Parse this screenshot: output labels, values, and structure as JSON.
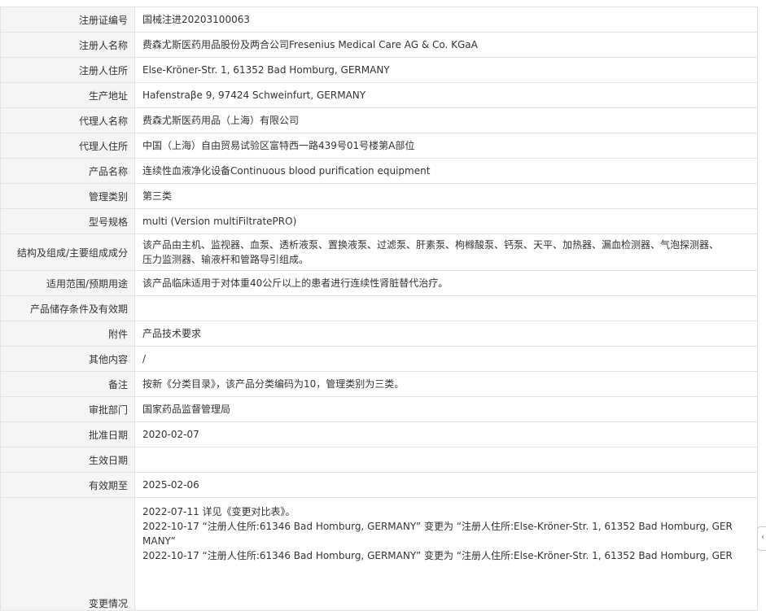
{
  "rows": [
    {
      "label": "注册证编号",
      "value": [
        "国械注进20203100063"
      ]
    },
    {
      "label": "注册人名称",
      "value": [
        "费森尤斯医药用品股份及两合公司Fresenius Medical Care AG & Co. KGaA"
      ]
    },
    {
      "label": "注册人住所",
      "value": [
        "Else-Kröner-Str. 1, 61352 Bad Homburg, GERMANY"
      ]
    },
    {
      "label": "生产地址",
      "value": [
        "Hafenstraβe 9, 97424 Schweinfurt, GERMANY"
      ]
    },
    {
      "label": "代理人名称",
      "value": [
        "费森尤斯医药用品（上海）有限公司"
      ]
    },
    {
      "label": "代理人住所",
      "value": [
        "中国（上海）自由贸易试验区富特西一路439号01号楼第A部位"
      ]
    },
    {
      "label": "产品名称",
      "value": [
        "连续性血液净化设备Continuous blood purification equipment"
      ]
    },
    {
      "label": "管理类别",
      "value": [
        "第三类"
      ]
    },
    {
      "label": "型号规格",
      "value": [
        "multi (Version multiFiltratePRO)"
      ]
    },
    {
      "label": "结构及组成/主要组成成分",
      "value": [
        "该产品由主机、监视器、血泵、透析液泵、置换液泵、过滤泵、肝素泵、枸橼酸泵、钙泵、天平、加热器、漏血检测器、气泡探测器、",
        "压力监测器、输液杆和管路导引组成。"
      ]
    },
    {
      "label": "适用范围/预期用途",
      "value": [
        "该产品临床适用于对体重40公斤以上的患者进行连续性肾脏替代治疗。"
      ]
    },
    {
      "label": "产品储存条件及有效期",
      "value": [
        ""
      ]
    },
    {
      "label": "附件",
      "value": [
        "产品技术要求"
      ]
    },
    {
      "label": "其他内容",
      "value": [
        "/"
      ]
    },
    {
      "label": "备注",
      "value": [
        "按新《分类目录》，该产品分类编码为10，管理类别为三类。"
      ]
    },
    {
      "label": "审批部门",
      "value": [
        "国家药品监督管理局"
      ]
    },
    {
      "label": "批准日期",
      "value": [
        "2020-02-07"
      ]
    },
    {
      "label": "生效日期",
      "value": [
        ""
      ]
    },
    {
      "label": "有效期至",
      "value": [
        "2025-02-06"
      ]
    }
  ],
  "changes": {
    "label": "变更情况",
    "lines": [
      "2022-07-11 详见《变更对比表》。",
      "2022-10-17 “注册人住所:61346 Bad Homburg, GERMANY” 变更为 “注册人住所:Else-Kröner-Str. 1, 61352 Bad Homburg, GER",
      "MANY”",
      "2022-10-17 “注册人住所:61346 Bad Homburg, GERMANY” 变更为 “注册人住所:Else-Kröner-Str. 1, 61352 Bad Homburg, GER"
    ]
  }
}
